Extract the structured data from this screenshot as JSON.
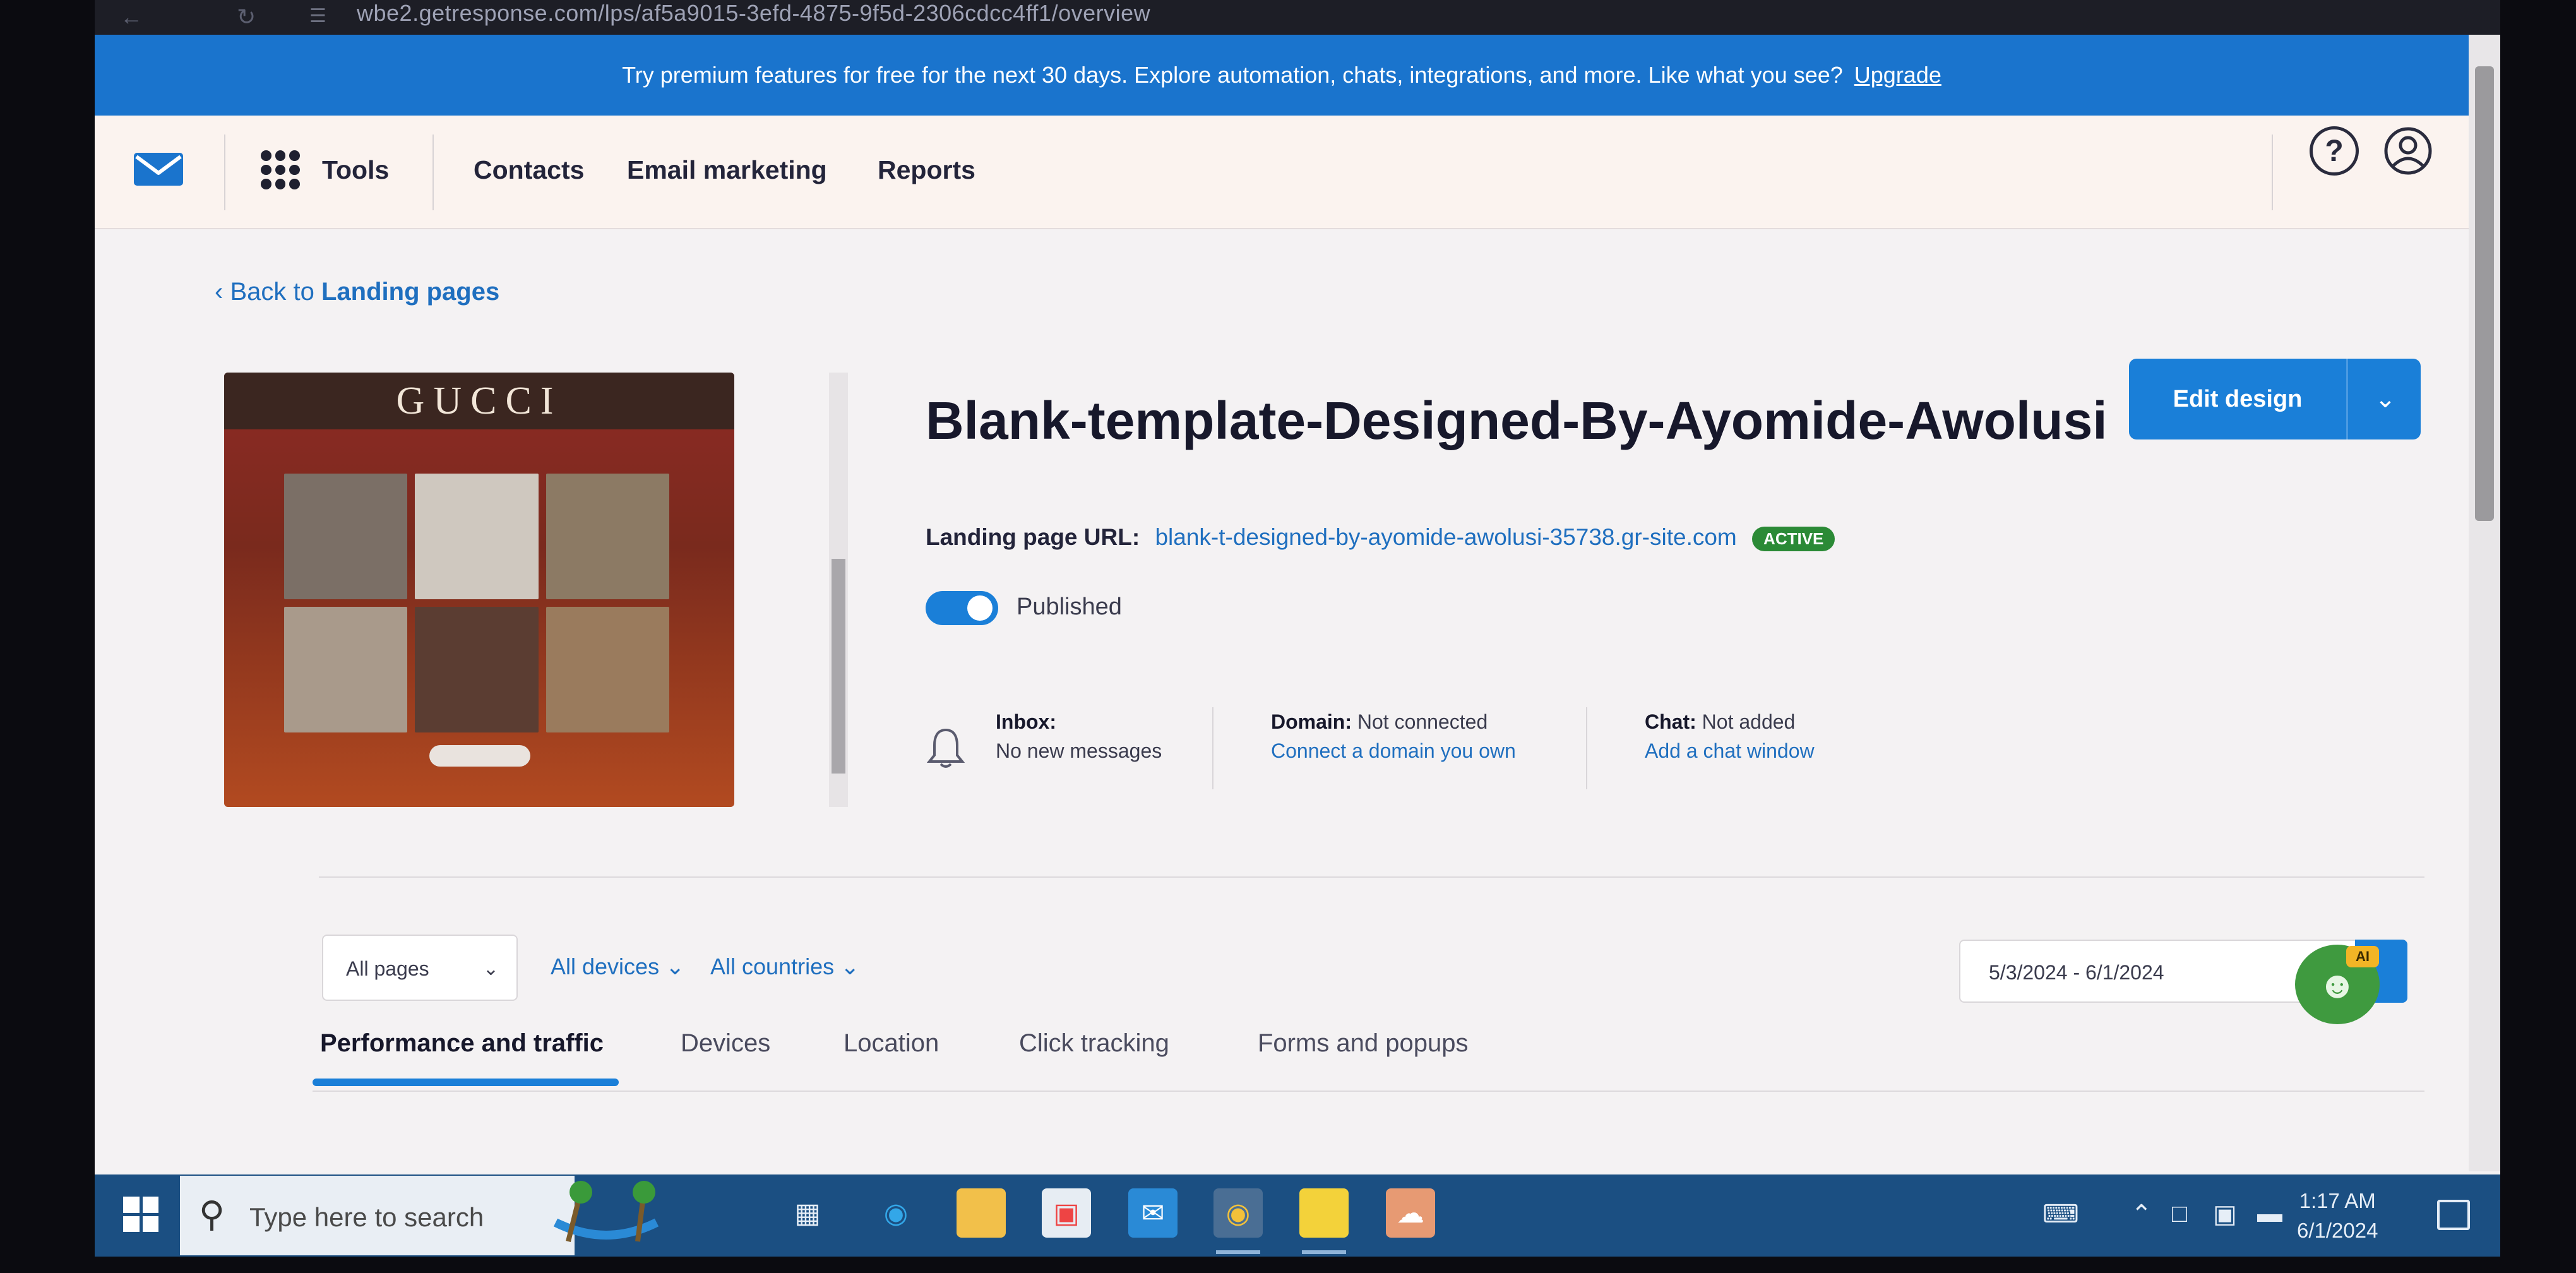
{
  "browser": {
    "url": "wbe2.getresponse.com/lps/af5a9015-3efd-4875-9f5d-2306cdcc4ff1/overview"
  },
  "promo": {
    "text": "Try premium features for free for the next 30 days. Explore automation, chats, integrations, and more. Like what you see?",
    "link": "Upgrade"
  },
  "nav": {
    "tools": "Tools",
    "contacts": "Contacts",
    "email_marketing": "Email marketing",
    "reports": "Reports",
    "help_glyph": "?"
  },
  "page": {
    "back_prefix": "Back to",
    "back_target": "Landing pages",
    "preview_brand": "GUCCI",
    "title": "Blank-template-Designed-By-Ayomide-Awolusi",
    "edit_label": "Edit design",
    "url_label": "Landing page URL:",
    "url": "blank-t-designed-by-ayomide-awolusi-35738.gr-site.com",
    "status_badge": "ACTIVE",
    "published_label": "Published",
    "published_on": true
  },
  "info": {
    "inbox_label": "Inbox:",
    "inbox_value": "No new messages",
    "domain_label": "Domain:",
    "domain_value": "Not connected",
    "domain_link": "Connect a domain you own",
    "chat_label": "Chat:",
    "chat_value": "Not added",
    "chat_link": "Add a chat window"
  },
  "filters": {
    "pages": "All pages",
    "devices": "All devices",
    "countries": "All countries",
    "date_range": "5/3/2024 - 6/1/2024",
    "ai_badge": "AI"
  },
  "tabs": [
    {
      "label": "Performance and traffic",
      "active": true
    },
    {
      "label": "Devices",
      "active": false
    },
    {
      "label": "Location",
      "active": false
    },
    {
      "label": "Click tracking",
      "active": false
    },
    {
      "label": "Forms and popups",
      "active": false
    }
  ],
  "taskbar": {
    "search_placeholder": "Type here to search",
    "time": "1:17 AM",
    "date": "6/1/2024",
    "apps": [
      "task-view-icon",
      "edge-icon",
      "file-explorer-icon",
      "store-icon",
      "mail-icon",
      "chrome-icon",
      "sticky-notes-icon",
      "photos-icon"
    ]
  },
  "colors": {
    "brand_blue": "#1a74cd",
    "active_green": "#2b8a36",
    "ai_green": "#3f9a3f"
  }
}
